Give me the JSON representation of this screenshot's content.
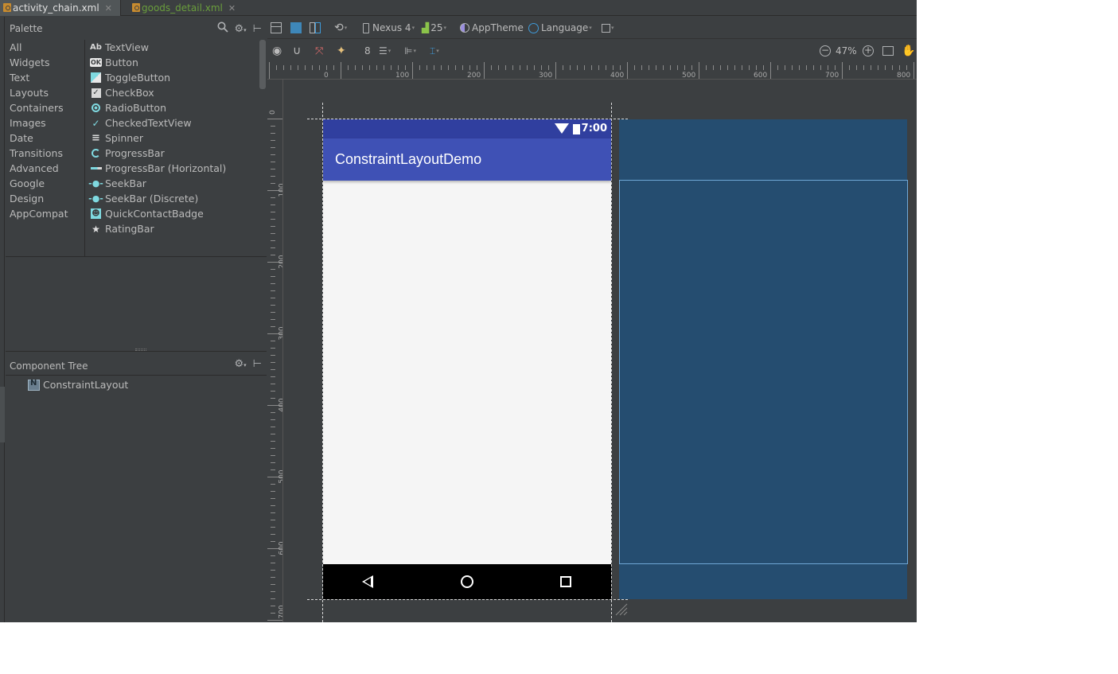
{
  "tabs": [
    {
      "label": "activity_chain.xml",
      "active": true
    },
    {
      "label": "goods_detail.xml",
      "active": false
    }
  ],
  "palette": {
    "title": "Palette",
    "categories": [
      "All",
      "Widgets",
      "Text",
      "Layouts",
      "Containers",
      "Images",
      "Date",
      "Transitions",
      "Advanced",
      "Google",
      "Design",
      "AppCompat"
    ],
    "items": [
      {
        "label": "TextView",
        "icon": "Ab"
      },
      {
        "label": "Button",
        "icon": "OK"
      },
      {
        "label": "ToggleButton",
        "icon": "toggle"
      },
      {
        "label": "CheckBox",
        "icon": "check"
      },
      {
        "label": "RadioButton",
        "icon": "radio"
      },
      {
        "label": "CheckedTextView",
        "icon": "checked-text"
      },
      {
        "label": "Spinner",
        "icon": "spinner"
      },
      {
        "label": "ProgressBar",
        "icon": "progress"
      },
      {
        "label": "ProgressBar (Horizontal)",
        "icon": "progress-h"
      },
      {
        "label": "SeekBar",
        "icon": "seekbar"
      },
      {
        "label": "SeekBar (Discrete)",
        "icon": "seekbar"
      },
      {
        "label": "QuickContactBadge",
        "icon": "contact"
      },
      {
        "label": "RatingBar",
        "icon": "star"
      }
    ]
  },
  "component_tree": {
    "title": "Component Tree",
    "root": "ConstraintLayout"
  },
  "toolbar": {
    "device": "Nexus 4",
    "api": "25",
    "theme": "AppTheme",
    "language": "Language",
    "margin": "8",
    "zoom": "47%"
  },
  "rulers": {
    "top": [
      "0",
      "100",
      "200",
      "300",
      "400",
      "500",
      "600",
      "700",
      "800"
    ],
    "left": [
      "0",
      "100",
      "200",
      "300",
      "400",
      "500",
      "600",
      "700"
    ]
  },
  "device_preview": {
    "time": "7:00",
    "app_title": "ConstraintLayoutDemo"
  },
  "colors": {
    "ide_background": "#3c3f41",
    "status_bar": "#303f9f",
    "app_bar": "#3f51b5",
    "blueprint": "#254d70",
    "inactive_tab": "#6a9e3c"
  }
}
